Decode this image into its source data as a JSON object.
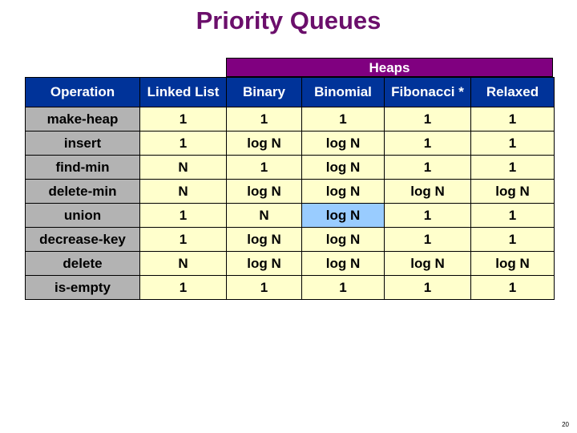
{
  "title": "Priority Queues",
  "group_header": "Heaps",
  "columns": [
    "Operation",
    "Linked List",
    "Binary",
    "Binomial",
    "Fibonacci *",
    "Relaxed"
  ],
  "rows": [
    {
      "op": "make-heap",
      "values": [
        "1",
        "1",
        "1",
        "1",
        "1"
      ]
    },
    {
      "op": "insert",
      "values": [
        "1",
        "log N",
        "log N",
        "1",
        "1"
      ]
    },
    {
      "op": "find-min",
      "values": [
        "N",
        "1",
        "log N",
        "1",
        "1"
      ]
    },
    {
      "op": "delete-min",
      "values": [
        "N",
        "log N",
        "log N",
        "log N",
        "log N"
      ]
    },
    {
      "op": "union",
      "values": [
        "1",
        "N",
        "log N",
        "1",
        "1"
      ]
    },
    {
      "op": "decrease-key",
      "values": [
        "1",
        "log N",
        "log N",
        "1",
        "1"
      ]
    },
    {
      "op": "delete",
      "values": [
        "N",
        "log N",
        "log N",
        "log N",
        "log N"
      ]
    },
    {
      "op": "is-empty",
      "values": [
        "1",
        "1",
        "1",
        "1",
        "1"
      ]
    }
  ],
  "highlight": {
    "row": 4,
    "col": 2,
    "color": "#99ccff"
  },
  "colors": {
    "title": "#6b0f6b",
    "group_header_bg": "#800080",
    "header_bg": "#003399",
    "op_bg": "#b3b3b3",
    "cell_bg": "#ffffcc"
  },
  "page_number": "20"
}
